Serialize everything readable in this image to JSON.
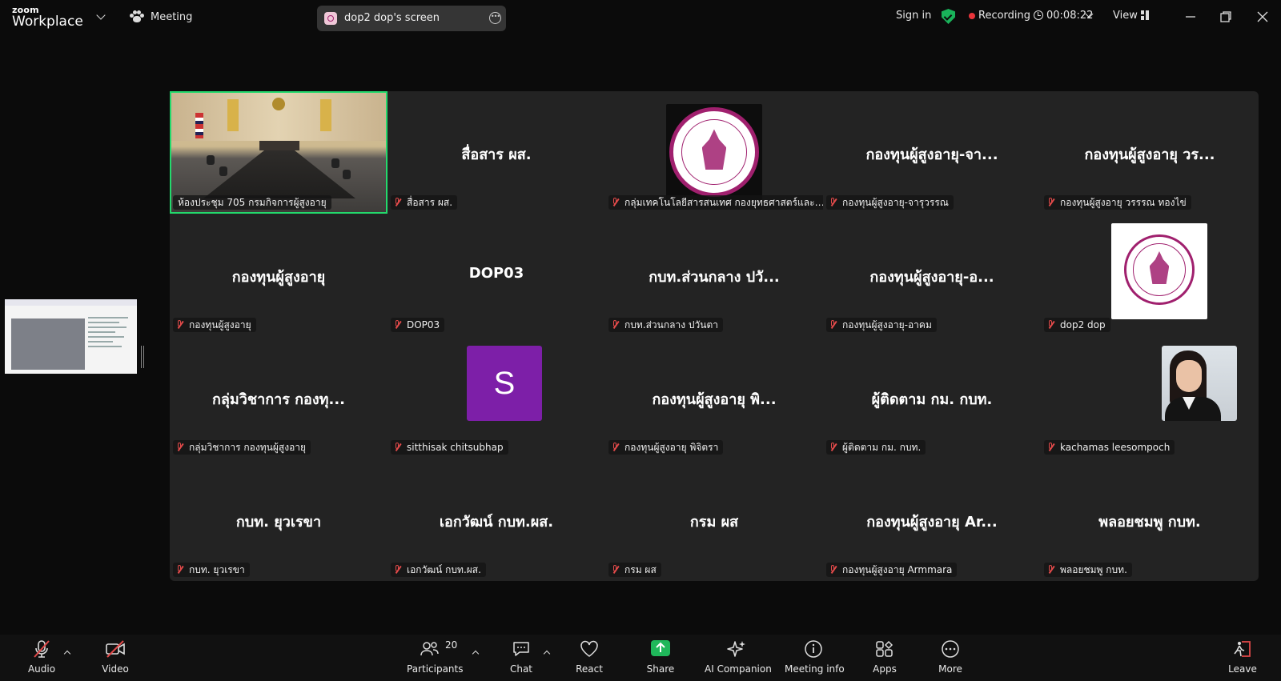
{
  "app": {
    "brand_top": "zoom",
    "brand_bottom": "Workplace"
  },
  "titlebar": {
    "meeting_label": "Meeting",
    "screen_share_label": "dop2 dop's screen",
    "sign_in": "Sign in",
    "recording": "Recording",
    "timer": "00:08:22",
    "view": "View"
  },
  "colors": {
    "active_border": "#23d96c",
    "recording": "#e8343a",
    "muted": "#e24a4a",
    "share_green": "#1fb75a",
    "avatar_purple": "#7d1fa8",
    "seal_magenta": "#a0206e"
  },
  "participants": [
    {
      "big": "",
      "label": "ห้องประชุม 705 กรมกิจการผู้สูงอายุ",
      "kind": "video",
      "active": true
    },
    {
      "big": "สื่อสาร ผส.",
      "label": "สื่อสาร ผส.",
      "kind": "name"
    },
    {
      "big": "",
      "label": "กลุ่มเทคโนโลยีสารสนเทศ กองยุทธศาสตร์และแผน...",
      "kind": "logo-black"
    },
    {
      "big": "กองทุนผู้สูงอายุ-จา...",
      "label": "กองทุนผู้สูงอายุ-จารุวรรณ",
      "kind": "name"
    },
    {
      "big": "กองทุนผู้สูงอายุ วร...",
      "label": "กองทุนผู้สูงอายุ วรรรณ ทองไข่",
      "kind": "name"
    },
    {
      "big": "กองทุนผู้สูงอายุ",
      "label": "กองทุนผู้สูงอายุ",
      "kind": "name"
    },
    {
      "big": "DOP03",
      "label": "DOP03",
      "kind": "name"
    },
    {
      "big": "กบท.ส่วนกลาง ปวั...",
      "label": "กบท.ส่วนกลาง ปวันตา",
      "kind": "name"
    },
    {
      "big": "กองทุนผู้สูงอายุ-อ...",
      "label": "กองทุนผู้สูงอายุ-อาคม",
      "kind": "name"
    },
    {
      "big": "",
      "label": "dop2 dop",
      "kind": "logo-white"
    },
    {
      "big": "กลุ่มวิชาการ กองทุ...",
      "label": "กลุ่มวิชาการ กองทุนผู้สูงอายุ",
      "kind": "name"
    },
    {
      "big": "S",
      "label": "sitthisak chitsubhap",
      "kind": "avatar"
    },
    {
      "big": "กองทุนผู้สูงอายุ พิ...",
      "label": "กองทุนผู้สูงอายุ พิจิตรา",
      "kind": "name"
    },
    {
      "big": "ผู้ติดตาม กม. กบท.",
      "label": "ผู้ติดตาม กม. กบท.",
      "kind": "name"
    },
    {
      "big": "",
      "label": "kachamas leesompoch",
      "kind": "photo"
    },
    {
      "big": "กบท. ยุวเรขา",
      "label": "กบท. ยุวเรขา",
      "kind": "name"
    },
    {
      "big": "เอกวัฒน์ กบท.ผส.",
      "label": "เอกวัฒน์ กบท.ผส.",
      "kind": "name"
    },
    {
      "big": "กรม ผส",
      "label": "กรม ผส",
      "kind": "name"
    },
    {
      "big": "กองทุนผู้สูงอายุ Ar...",
      "label": "กองทุนผู้สูงอายุ Armmara",
      "kind": "name"
    },
    {
      "big": "พลอยชมพู กบท.",
      "label": "พลอยชมพู กบท.",
      "kind": "name"
    }
  ],
  "toolbar": {
    "audio": "Audio",
    "video": "Video",
    "participants": "Participants",
    "participants_count": "20",
    "chat": "Chat",
    "react": "React",
    "share": "Share",
    "ai_companion": "AI Companion",
    "meeting_info": "Meeting info",
    "apps": "Apps",
    "more": "More",
    "leave": "Leave"
  }
}
